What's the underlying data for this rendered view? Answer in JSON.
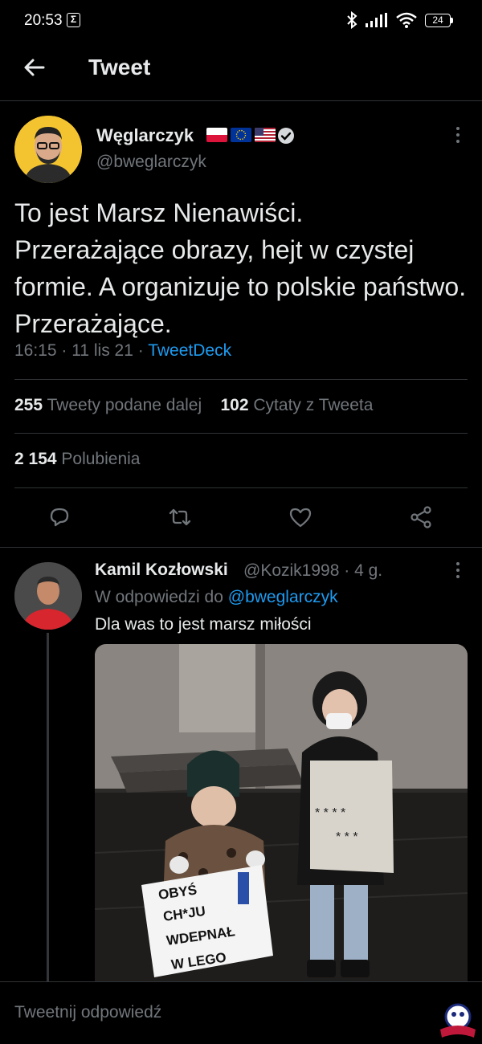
{
  "status_bar": {
    "time": "20:53",
    "notification_icon": "sigma-icon",
    "battery": "24"
  },
  "header": {
    "title": "Tweet"
  },
  "tweet": {
    "author_name": "Węglarczyk",
    "author_handle": "@bweglarczyk",
    "flags": [
      "poland-flag",
      "eu-flag",
      "usa-flag"
    ],
    "verified": true,
    "text": "To jest Marsz Nienawiści.\nPrzerażające obrazy, hejt w czystej formie. A organizuje to polskie państwo. Przerażające.",
    "time": "16:15",
    "date": "11 lis 21",
    "source": "TweetDeck",
    "retweets_count": "255",
    "retweets_label": "Tweety podane dalej",
    "quotes_count": "102",
    "quotes_label": "Cytaty z Tweeta",
    "likes_count": "2 154",
    "likes_label": "Polubienia"
  },
  "reply": {
    "author_name": "Kamil Kozłowski",
    "author_handle": "@Kozik1998",
    "age": "4 g.",
    "reply_to_prefix": "W odpowiedzi do",
    "reply_to_handle": "@bweglarczyk",
    "text": "Dla was to jest marsz miłości",
    "sign1": [
      "OBYŚ",
      "CH*JU",
      "WDEPNAŁ",
      "W   LEGO"
    ],
    "sign2_row1": "* * * *",
    "sign2_row2": "* * *"
  },
  "composer": {
    "placeholder": "Tweetnij odpowiedź"
  },
  "colors": {
    "background": "#000000",
    "text": "#e7e9ea",
    "secondary": "#71767b",
    "accent": "#1d9bf0",
    "divider": "#2f3336"
  }
}
